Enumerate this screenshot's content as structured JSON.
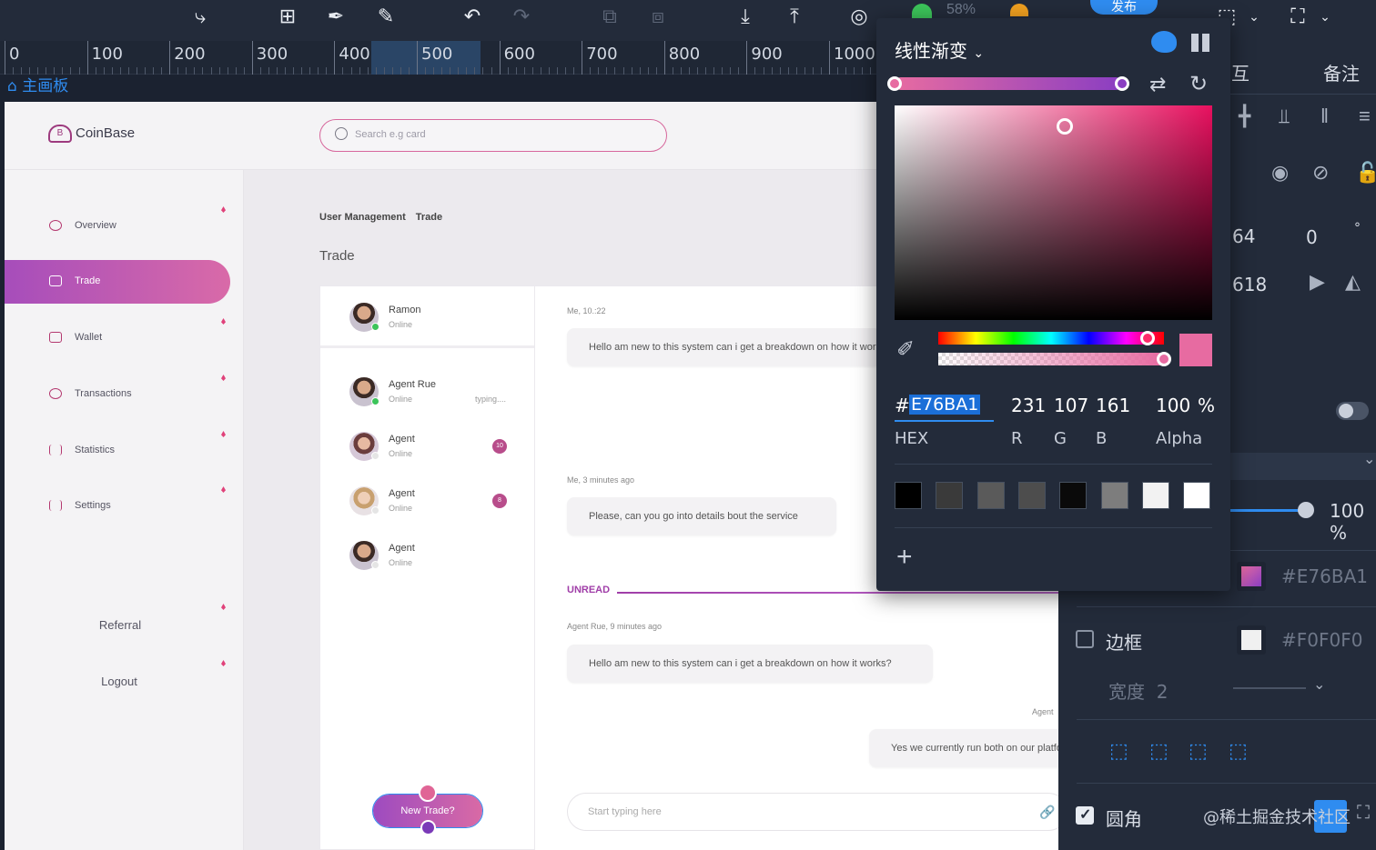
{
  "toolbar": {
    "zoom_text": "58%",
    "publish_label": "发布"
  },
  "ruler": {
    "labels": [
      "0",
      "100",
      "200",
      "300",
      "400",
      "500",
      "600",
      "700",
      "800",
      "900",
      "1000"
    ]
  },
  "artboard": {
    "label": "主画板"
  },
  "app": {
    "brand": "CoinBase",
    "search_placeholder": "Search e.g card",
    "nav": [
      "Overview",
      "Trade",
      "Wallet",
      "Transactions",
      "Statistics",
      "Settings"
    ],
    "referral": "Referral",
    "logout": "Logout",
    "breadcrumb": [
      "User Management",
      "Trade"
    ],
    "page_title": "Trade",
    "contacts": [
      {
        "name": "Ramon",
        "status": "Online",
        "typing": "",
        "badge": ""
      },
      {
        "name": "Agent Rue",
        "status": "Online",
        "typing": "typing....",
        "badge": ""
      },
      {
        "name": "Agent",
        "status": "Online",
        "typing": "",
        "badge": "10"
      },
      {
        "name": "Agent",
        "status": "Online",
        "typing": "",
        "badge": "8"
      },
      {
        "name": "Agent",
        "status": "Online",
        "typing": "",
        "badge": ""
      }
    ],
    "new_trade": "New Trade?",
    "chat": {
      "meta1": "Me, 10.:22",
      "msg1": "Hello am new to this system can i get a breakdown on how it works?",
      "meta2": "Me, 3 minutes ago",
      "msg2": "Please, can you go into details bout the service",
      "unread": "UNREAD",
      "meta3": "Agent Rue, 9 minutes ago",
      "msg3": "Hello am new to this system can i get a breakdown on how it works?",
      "meta4": "Agent",
      "msg4": "Yes we currently run both on our platform",
      "input_placeholder": "Start typing here"
    }
  },
  "picker": {
    "title": "线性渐变",
    "hex_symbol": "#",
    "hex": "E76BA1",
    "r": "231",
    "g": "107",
    "b": "161",
    "alpha": "100",
    "alpha_unit": "%",
    "hex_label": "HEX",
    "r_label": "R",
    "g_label": "G",
    "b_label": "B",
    "alpha_label": "Alpha",
    "swatches": [
      "#000000",
      "#3a3a3a",
      "#5a5a5a",
      "#4d4d4d",
      "#0a0a0a",
      "#7d7d7d",
      "#f2f2f2",
      "#ffffff"
    ],
    "add": "+"
  },
  "right_panel": {
    "tab_interact": "互",
    "tab_notes": "备注",
    "x_value": "64",
    "rotation": "0",
    "degree": "°",
    "y_value": "618",
    "opacity": "100",
    "opacity_unit": "%",
    "fill_hex": "#E76BA1",
    "border_label": "边框",
    "border_hex": "#F0F0F0",
    "width_label": "宽度",
    "width_value": "2",
    "radius_label": "圆角"
  },
  "watermark": "@稀土掘金技术社区",
  "colors": {
    "accent": "#e76ba1",
    "brand_purple": "#9d4bc0",
    "select_blue": "#2f8cf0"
  }
}
